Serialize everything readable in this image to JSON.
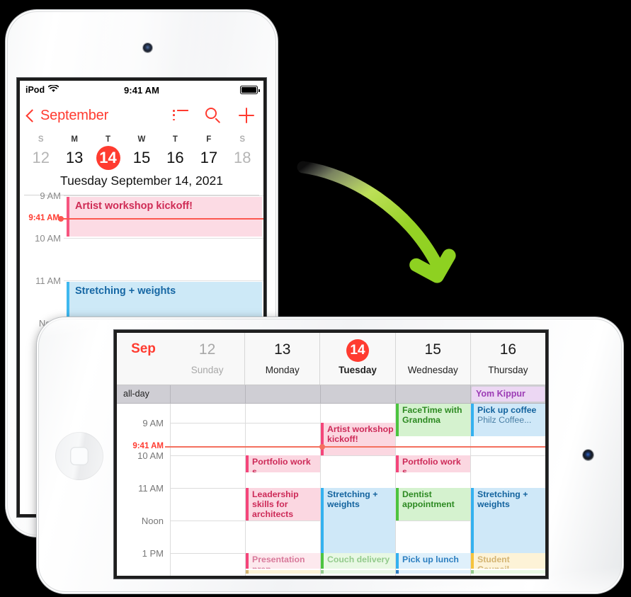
{
  "ipod": {
    "status_bar": {
      "carrier": "iPod",
      "wifi_icon": "wifi-icon",
      "time": "9:41 AM",
      "battery_icon": "battery-full-icon"
    },
    "nav": {
      "back_label": "September",
      "back_icon": "chevron-left-icon",
      "list_icon": "list-icon",
      "search_icon": "search-icon",
      "add_icon": "plus-icon"
    },
    "week": {
      "dows": [
        "S",
        "M",
        "T",
        "W",
        "T",
        "F",
        "S"
      ],
      "days": [
        "12",
        "13",
        "14",
        "15",
        "16",
        "17",
        "18"
      ],
      "selected_index": 2,
      "dim_indexes": [
        0,
        6
      ]
    },
    "selected_date_line": "Tuesday  September 14, 2021",
    "hours": [
      "9 AM",
      "10 AM",
      "11 AM",
      "Noon"
    ],
    "now_label": "9:41 AM",
    "events": [
      {
        "title": "Artist workshop kickoff!",
        "color": "pink"
      },
      {
        "title": "Stretching + weights",
        "color": "blue"
      }
    ]
  },
  "ipad": {
    "month": "Sep",
    "days": [
      {
        "num": "12",
        "name": "Sunday",
        "dim": true,
        "today": false
      },
      {
        "num": "13",
        "name": "Monday",
        "dim": false,
        "today": false
      },
      {
        "num": "14",
        "name": "Tuesday",
        "dim": false,
        "today": true
      },
      {
        "num": "15",
        "name": "Wednesday",
        "dim": false,
        "today": false
      },
      {
        "num": "16",
        "name": "Thursday",
        "dim": false,
        "today": false
      }
    ],
    "all_day_label": "all-day",
    "all_day_events": [
      {
        "col": 4,
        "title": "Yom Kippur",
        "color": "purple"
      }
    ],
    "hours": [
      "9 AM",
      "10 AM",
      "11 AM",
      "Noon",
      "1 PM"
    ],
    "now_label": "9:41 AM",
    "events": [
      {
        "col": 2,
        "title": "Artist workshop kickoff!",
        "color": "pink",
        "sub": ""
      },
      {
        "col": 3,
        "title": "FaceTime with Grandma",
        "color": "green",
        "sub": ""
      },
      {
        "col": 4,
        "title": "Pick up coffee",
        "color": "blue",
        "sub": "Philz Coffee..."
      },
      {
        "col": 1,
        "title": "Portfolio work s...",
        "color": "pink",
        "sub": ""
      },
      {
        "col": 3,
        "title": "Portfolio work s...",
        "color": "pink",
        "sub": ""
      },
      {
        "col": 1,
        "title": "Leadership skills for architects",
        "color": "pink",
        "sub": ""
      },
      {
        "col": 2,
        "title": "Stretching + weights",
        "color": "blue",
        "sub": ""
      },
      {
        "col": 3,
        "title": "Dentist appointment",
        "color": "green",
        "sub": ""
      },
      {
        "col": 4,
        "title": "Stretching + weights",
        "color": "blue",
        "sub": ""
      },
      {
        "col": 1,
        "title": "Presentation prep",
        "color": "faint-pink",
        "sub": ""
      },
      {
        "col": 2,
        "title": "Couch delivery",
        "color": "faint-green",
        "sub": ""
      },
      {
        "col": 3,
        "title": "Pick up lunch",
        "color": "faint-blue",
        "sub": ""
      },
      {
        "col": 4,
        "title": "Student Council...",
        "color": "faint-yellow",
        "sub": ""
      }
    ]
  },
  "annotation": {
    "arrow_icon": "curved-arrow-down-right-icon",
    "arrow_color": "#8ed121"
  },
  "colors": {
    "accent_red": "#ff3b30",
    "now_line": "#f4705f",
    "pink_event_bg": "#fbd7e1",
    "pink_event_bar": "#f4457a",
    "blue_event_bg": "#cfe8f8",
    "blue_event_bar": "#34b1ef",
    "green_event_bg": "#d5f2cf",
    "green_event_bar": "#4cc43f",
    "purple_event_bg": "#ecd7f3",
    "purple_event_text": "#9c3cb5",
    "allday_bg": "#cfced4"
  }
}
